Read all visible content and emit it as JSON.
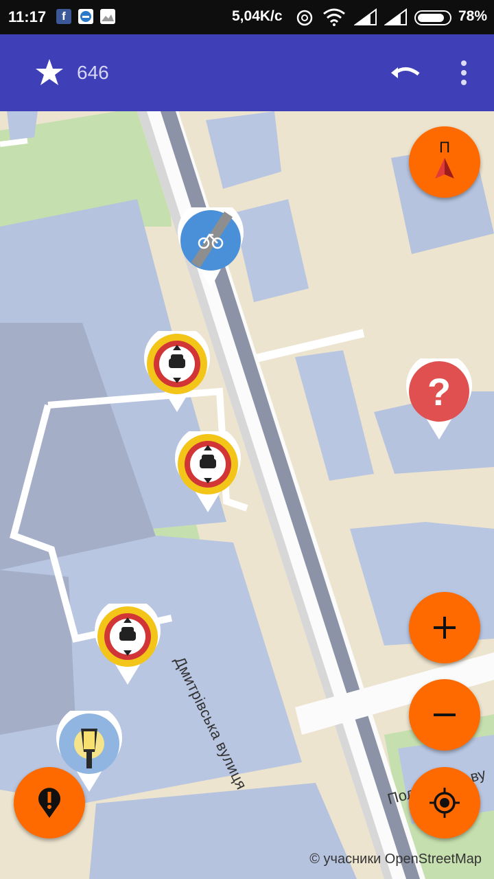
{
  "status_bar": {
    "time": "11:17",
    "network_speed": "5,04K/c",
    "battery_percent": "78%"
  },
  "toolbar": {
    "star_count": "646"
  },
  "map": {
    "compass_letter": "П",
    "street_dmytrivska": "Дмитрівська вулиця",
    "street_poltavska": "Полтавська ву",
    "attribution": "© учасники OpenStreetMap"
  },
  "colors": {
    "toolbar": "#3f3fb7",
    "fab": "#ff6a00",
    "pin_red": "#e15050"
  },
  "icons": {
    "pins": [
      "cycleway-pin",
      "no-motor-vehicles-pin",
      "no-motor-vehicles-pin",
      "no-motor-vehicles-pin",
      "street-lamp-pin",
      "help-pin"
    ]
  }
}
